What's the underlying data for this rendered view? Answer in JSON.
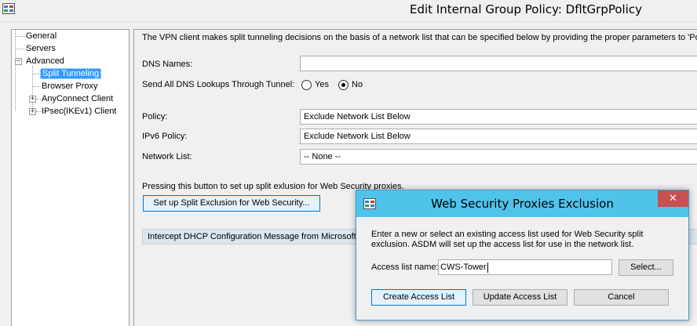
{
  "window": {
    "title": "Edit Internal Group Policy: DfltGrpPolicy"
  },
  "tree": {
    "items": [
      {
        "label": "General"
      },
      {
        "label": "Servers"
      },
      {
        "label": "Advanced",
        "expander": "⊟"
      },
      {
        "label": "Split Tunneling",
        "selected": true
      },
      {
        "label": "Browser Proxy"
      },
      {
        "label": "AnyConnect Client",
        "expander": "⊞"
      },
      {
        "label": "IPsec(IKEv1) Client",
        "expander": "⊞"
      }
    ]
  },
  "content": {
    "description": "The VPN client makes split tunneling decisions on the basis of a network list that can be specified below by providing the proper parameters to 'Policy' and 'Network List' fields.",
    "dns_names_label": "DNS Names:",
    "dns_names_value": "",
    "send_all_dns_label": "Send All DNS Lookups Through Tunnel:",
    "radio_yes_label": "Yes",
    "radio_no_label": "No",
    "radio_selected": "No",
    "policy_label": "Policy:",
    "policy_value": "Exclude Network List Below",
    "ipv6_policy_label": "IPv6 Policy:",
    "ipv6_policy_value": "Exclude Network List Below",
    "network_list_label": "Network List:",
    "network_list_value": "-- None --",
    "split_exclusion_note": "Pressing this button to set up split exlusion for Web Security proxies.",
    "split_exclusion_button": "Set up Split Exclusion for Web Security...",
    "intercept_dhcp_bar": "Intercept DHCP Configuration Message from Microsoft Clients"
  },
  "dialog": {
    "title": "Web Security Proxies Exclusion",
    "close_glyph": "✕",
    "instructions": "Enter a new or select an existing access list used for Web Security split exclusion. ASDM will set up the access list for use in the network list.",
    "access_list_label": "Access list name:",
    "access_list_value": "CWS-Tower",
    "select_button": "Select...",
    "create_button": "Create Access List",
    "update_button": "Update Access List",
    "cancel_button": "Cancel"
  },
  "icons": {
    "app_icon": "asdm-app-icon",
    "dialog_icon": "asdm-app-icon"
  },
  "colors": {
    "dialog_titlebar": "#4fc3ea",
    "close_button": "#c75050",
    "selection": "#3399ff",
    "section_bar": "#dce4ee"
  }
}
